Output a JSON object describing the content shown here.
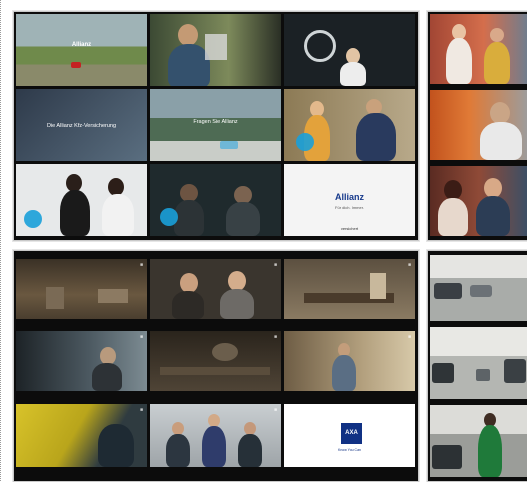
{
  "board_a": {
    "tile_captions": [
      "Allianz",
      "Die Allianz Kfz-Versicherung",
      "Fragen Sie Allianz"
    ],
    "end_card": {
      "logo": "Allianz",
      "tagline": "Für dich. Immer.",
      "url": "versichert"
    }
  },
  "board_c": {
    "end_card": {
      "logo": "AXA",
      "tagline": "Know You Can"
    }
  },
  "colors": {
    "allianz_blue": "#173a8c",
    "axa_blue": "#103184",
    "bubble": "#1aa0d9"
  }
}
